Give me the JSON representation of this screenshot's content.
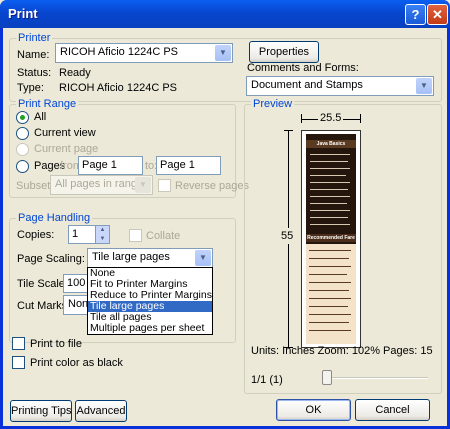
{
  "window": {
    "title": "Print",
    "help_glyph": "?",
    "close_glyph": "✕"
  },
  "printer": {
    "group_label": "Printer",
    "name_label": "Name:",
    "name_value": "RICOH Aficio 1224C PS",
    "properties_label": "Properties",
    "status_label": "Status:",
    "status_value": "Ready",
    "type_label": "Type:",
    "type_value": "RICOH Aficio 1224C PS",
    "comments_label": "Comments and Forms:",
    "comments_value": "Document and Stamps"
  },
  "print_range": {
    "group_label": "Print Range",
    "all_label": "All",
    "current_view_label": "Current view",
    "current_page_label": "Current page",
    "pages_label": "Pages",
    "from_label": "from:",
    "from_value": "Page 1",
    "to_label": "to:",
    "to_value": "Page 1",
    "subset_label": "Subset:",
    "subset_value": "All pages in range",
    "reverse_label": "Reverse pages"
  },
  "page_handling": {
    "group_label": "Page Handling",
    "copies_label": "Copies:",
    "copies_value": "1",
    "collate_label": "Collate",
    "scaling_label": "Page Scaling:",
    "scaling_value": "Tile large pages",
    "scaling_options": [
      "None",
      "Fit to Printer Margins",
      "Reduce to Printer Margins",
      "Tile large pages",
      "Tile all pages",
      "Multiple pages per sheet"
    ],
    "scaling_selected_index": 3,
    "tile_scale_label": "Tile Scale:",
    "tile_scale_value": "100",
    "cut_marks_label": "Cut Marks:",
    "cut_marks_value": "None"
  },
  "options": {
    "print_to_file_label": "Print to file",
    "print_color_black_label": "Print color as black"
  },
  "preview": {
    "group_label": "Preview",
    "width_value": "25.5",
    "height_value": "55",
    "menu_title_1": "Java Basics",
    "menu_title_2": "Recommended Fare",
    "units_text": "Units: Inches  Zoom: 102%  Pages: 15",
    "page_counter": "1/1 (1)"
  },
  "buttons": {
    "printing_tips": "Printing Tips",
    "advanced": "Advanced",
    "ok": "OK",
    "cancel": "Cancel"
  }
}
